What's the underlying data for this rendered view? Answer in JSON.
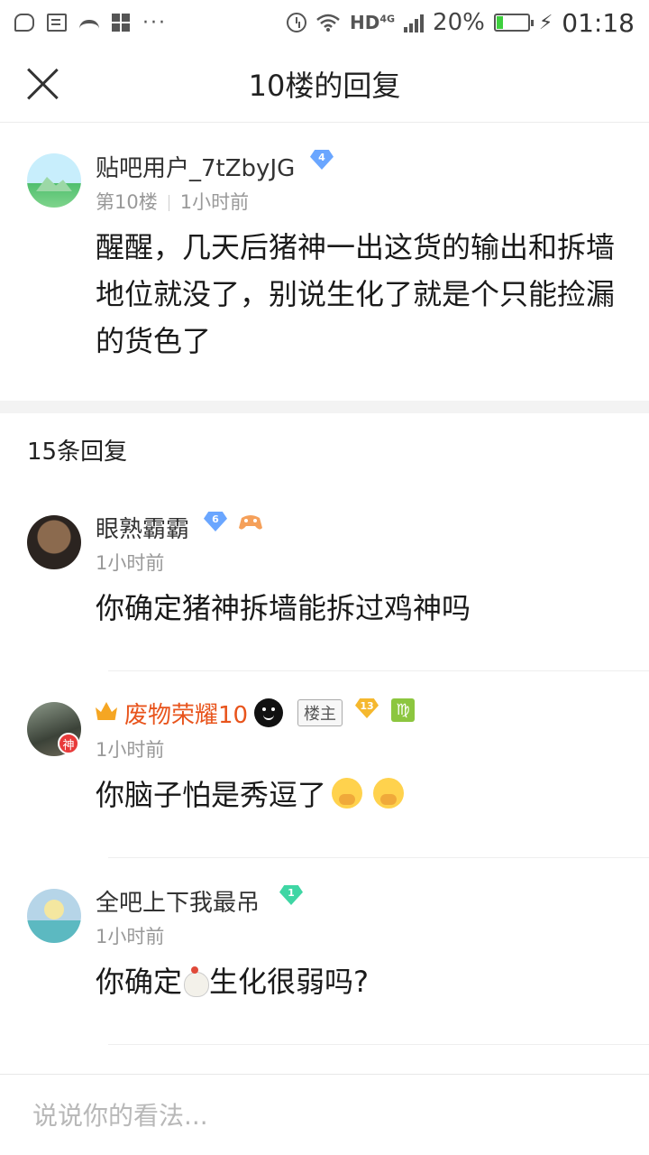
{
  "status_bar": {
    "network": "HD",
    "network_type": "4G",
    "battery_percent": "20%",
    "battery_level": 0.2,
    "time": "01:18"
  },
  "header": {
    "title": "10楼的回复"
  },
  "main_post": {
    "username": "贴吧用户_7tZbyJG",
    "level": "4",
    "floor": "第10楼",
    "time": "1小时前",
    "content": "醒醒，几天后猪神一出这货的输出和拆墙地位就没了，别说生化了就是个只能捡漏的货色了"
  },
  "replies_count": "15条回复",
  "replies": [
    {
      "username": "眼熟霸霸",
      "level": "6",
      "time": "1小时前",
      "content": "你确定猪神拆墙能拆过鸡神吗"
    },
    {
      "username": "废物荣耀10",
      "avatar_badge": "神",
      "owner_tag": "楼主",
      "level": "13",
      "zodiac": "♍",
      "time": "1小时前",
      "content": "你脑子怕是秀逗了"
    },
    {
      "username": "全吧上下我最吊",
      "level": "1",
      "time": "1小时前",
      "content_before": "你确定",
      "content_after": "生化很弱吗?"
    }
  ],
  "input": {
    "placeholder": "说说你的看法..."
  },
  "colors": {
    "gem_blue": "#6aa6ff",
    "gem_gold": "#f5b82e",
    "gem_green": "#3fd6a4",
    "vip_name": "#e8541c",
    "zodiac_green": "#8cc63f"
  }
}
